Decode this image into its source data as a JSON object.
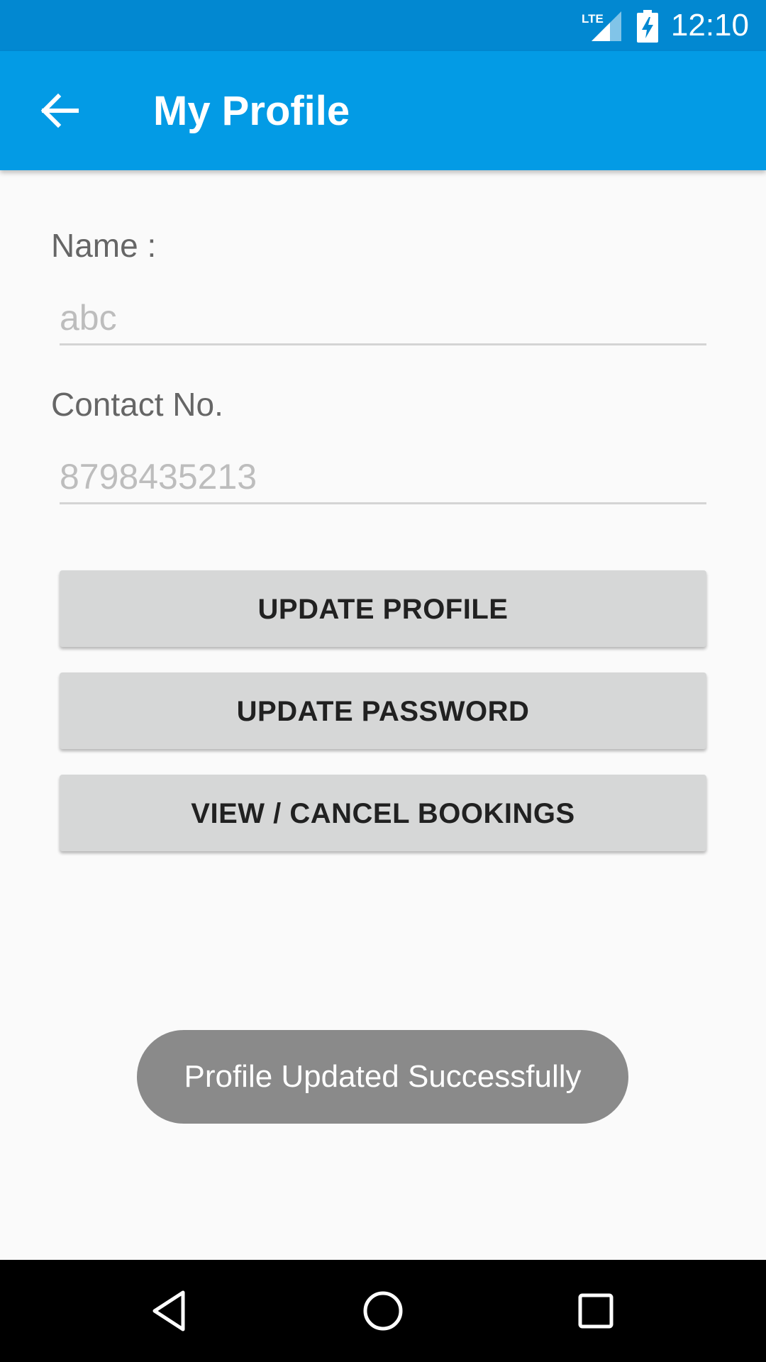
{
  "status_bar": {
    "network": "LTE",
    "time": "12:10",
    "icons": [
      "lte-signal-icon",
      "battery-charging-icon"
    ]
  },
  "app_bar": {
    "title": "My Profile",
    "back_icon": "arrow-back-icon"
  },
  "form": {
    "name_label": "Name :",
    "name_value": "abc",
    "contact_label": "Contact No.",
    "contact_value": "8798435213"
  },
  "buttons": {
    "update_profile": "UPDATE PROFILE",
    "update_password": "UPDATE PASSWORD",
    "view_cancel_bookings": "VIEW / CANCEL BOOKINGS"
  },
  "toast": {
    "message": "Profile Updated Successfully"
  },
  "nav_bar": {
    "icons": [
      "nav-back-icon",
      "nav-home-icon",
      "nav-recents-icon"
    ]
  },
  "colors": {
    "status_bar": "#0288d1",
    "app_bar": "#039be5",
    "button": "#d6d7d7",
    "toast": "#8a8a8a"
  }
}
